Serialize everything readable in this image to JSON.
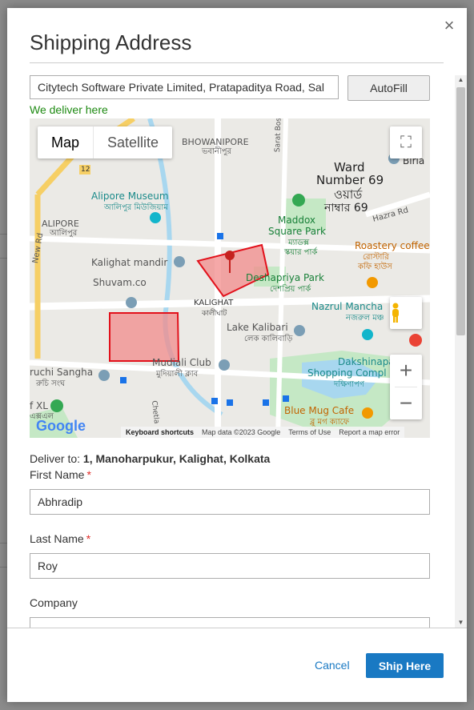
{
  "dialog": {
    "title": "Shipping Address",
    "close_glyph": "×"
  },
  "address_search": {
    "value": "Citytech Software Private Limited, Pratapaditya Road, Sal",
    "autofill_label": "AutoFill",
    "deliver_note": "We deliver here"
  },
  "map": {
    "type_buttons": [
      "Map",
      "Satellite"
    ],
    "place_labels": [
      "BHOWANIPORE",
      "ভবানীপুর",
      "Ward",
      "Number 69",
      "ওয়ার্ড",
      "নাম্বার 69",
      "Sarat Bose Rd",
      "Hazra Rd",
      "Birla",
      "Alipore Museum",
      "আলিপুর মিউজিয়াম",
      "ALIPORE",
      "আলিপুর",
      "New Rd",
      "Maddox",
      "Square Park",
      "ম্যাডক্স",
      "স্কয়ার পার্ক",
      "Roastery coffee",
      "রোস্টারি",
      "কফি হাউস",
      "Kalighat mandir",
      "Deshapriya Park",
      "দেশপ্রিয় পার্ক",
      "Shuvam.co",
      "KALIGHAT",
      "কালীঘাট",
      "Nazrul Mancha",
      "নজরুল মঞ্চ",
      "Lake Kalibari",
      "লেক কালিবাড়ি",
      "Mudiali Club",
      "মুদিয়ালী ক্লাব",
      "Dakshinapan",
      "Shopping Compl",
      "দক্ষিণাপণ",
      "ruchi Sangha",
      "রুচি সংঘ",
      "Blue Mug Cafe",
      "ব্লু মগ ক্যাফে",
      "Chetla",
      "f XL",
      "এক্সএল",
      "12"
    ],
    "google_logo": "Google",
    "attribution": {
      "shortcuts": "Keyboard shortcuts",
      "data": "Map data ©2023 Google",
      "terms": "Terms of Use",
      "report": "Report a map error"
    },
    "zoom_in": "+",
    "zoom_out": "−",
    "colors": {
      "zone_fill": "#f28b8b",
      "zone_stroke": "#e2111b",
      "park": "#c5e8c5",
      "water": "#a8d7ef",
      "road": "#ffffff",
      "arterial": "#f6cf65"
    }
  },
  "deliver_to": {
    "label": "Deliver to:",
    "value": "1, Manoharpukur, Kalighat, Kolkata"
  },
  "form": {
    "first_name": {
      "label": "First Name",
      "required": "*",
      "value": "Abhradip"
    },
    "last_name": {
      "label": "Last Name",
      "required": "*",
      "value": "Roy"
    },
    "company": {
      "label": "Company",
      "value": ""
    }
  },
  "footer": {
    "cancel_label": "Cancel",
    "ship_label": "Ship Here"
  },
  "colors": {
    "primary": "#1979c3",
    "success": "#1e8a12",
    "required": "#e02b27"
  }
}
